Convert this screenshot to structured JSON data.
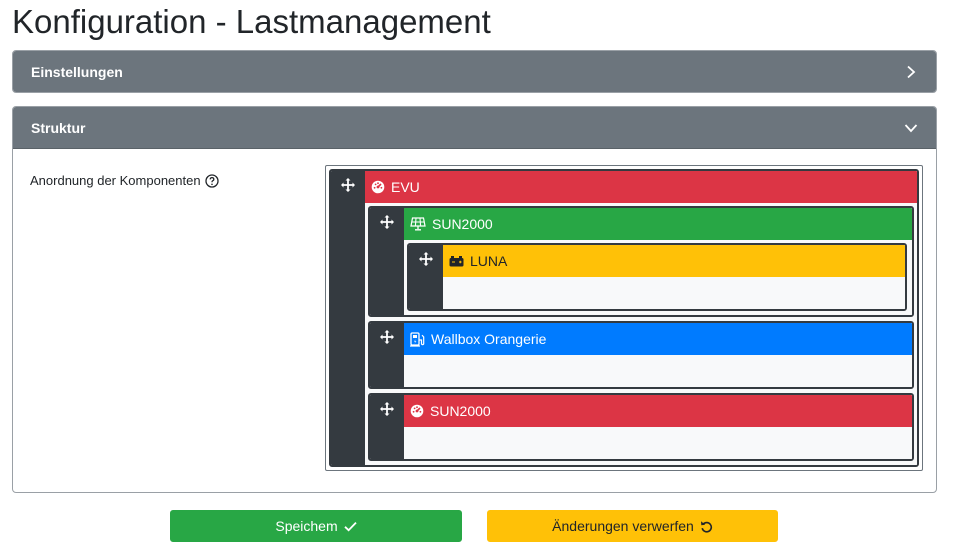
{
  "page": {
    "title": "Konfiguration - Lastmanagement"
  },
  "cards": {
    "settings": {
      "title": "Einstellungen",
      "icon": "chevron-right-icon"
    },
    "structure": {
      "title": "Struktur",
      "icon": "chevron-down-icon",
      "label": "Anordnung der Komponenten"
    }
  },
  "tree": {
    "evu": {
      "label": "EVU",
      "icon": "gauge-icon",
      "color": "#dc3545"
    },
    "sun1": {
      "label": "SUN2000",
      "icon": "solar-panel-icon",
      "color": "#28a745"
    },
    "luna": {
      "label": "LUNA",
      "icon": "battery-icon",
      "color": "#ffc107"
    },
    "wallbox": {
      "label": "Wallbox Orangerie",
      "icon": "charging-station-icon",
      "color": "#007bff"
    },
    "sun2": {
      "label": "SUN2000",
      "icon": "gauge-icon",
      "color": "#dc3545"
    }
  },
  "actions": {
    "save": {
      "label": "Speichem",
      "icon": "check-icon"
    },
    "discard": {
      "label": "Änderungen verwerfen",
      "icon": "undo-icon"
    }
  }
}
